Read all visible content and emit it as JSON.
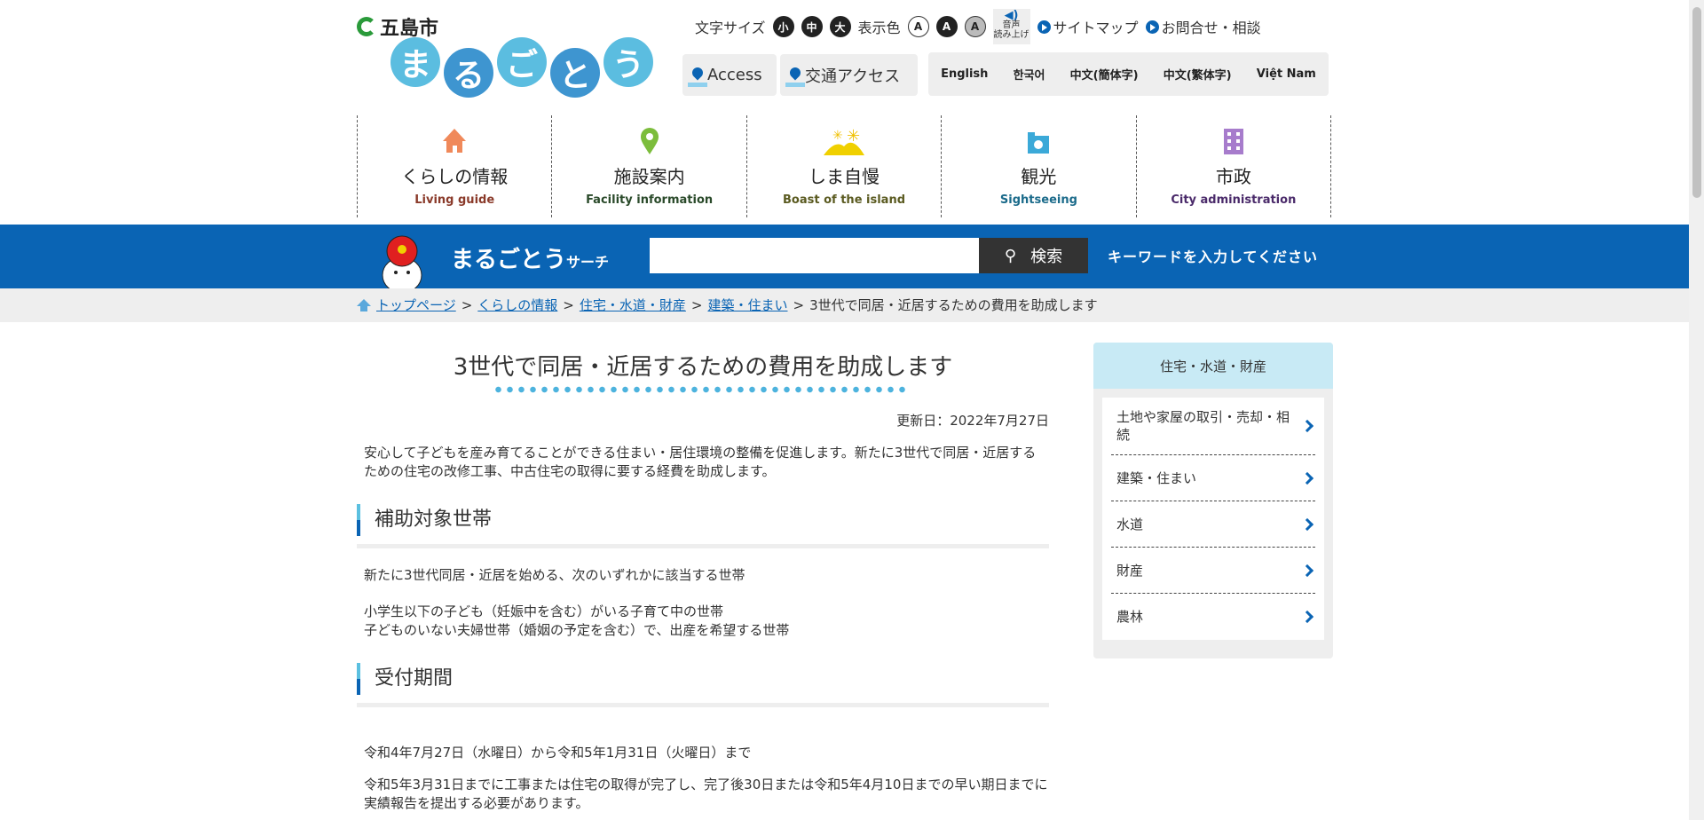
{
  "header": {
    "city": "五島市",
    "logo": "まるごとう",
    "util": {
      "font_size_label": "文字サイズ",
      "sizes": [
        "小",
        "中",
        "大"
      ],
      "color_label": "表示色",
      "colors": [
        "A",
        "A",
        "A"
      ],
      "voice": "音声",
      "voice2": "読み上げ",
      "sitemap": "サイトマップ",
      "contact": "お問合せ・相談"
    },
    "access": "Access",
    "transport": "交通アクセス",
    "languages": [
      "English",
      "한국어",
      "中文(簡体字)",
      "中文(繁体字)",
      "Việt Nam"
    ]
  },
  "nav": [
    {
      "jp": "くらしの情報",
      "en": "Living guide",
      "color": "#8a3a2a",
      "icon": "house-icon"
    },
    {
      "jp": "施設案内",
      "en": "Facility information",
      "color": "#2a4a2a",
      "icon": "map-pin-icon"
    },
    {
      "jp": "しま自慢",
      "en": "Boast of the island",
      "color": "#5a5a20",
      "icon": "island-sun-icon"
    },
    {
      "jp": "観光",
      "en": "Sightseeing",
      "color": "#1a6a8a",
      "icon": "camera-icon"
    },
    {
      "jp": "市政",
      "en": "City administration",
      "color": "#4a2a6a",
      "icon": "building-icon"
    }
  ],
  "search": {
    "logo": "まるごとう",
    "logo_suffix": "サーチ",
    "button": "検索",
    "hint": "キーワードを入力してください",
    "value": ""
  },
  "breadcrumb": {
    "links": [
      "トップページ",
      "くらしの情報",
      "住宅・水道・財産",
      "建築・住まい"
    ],
    "current": "3世代で同居・近居するための費用を助成します",
    "sep": ">"
  },
  "main": {
    "title": "3世代で同居・近居するための費用を助成します",
    "updated": "更新日：2022年7月27日",
    "intro": "安心して子どもを産み育てることができる住まい・居住環境の整備を促進します。新たに3世代で同居・近居するための住宅の改修工事、中古住宅の取得に要する経費を助成します。",
    "section1": {
      "heading": "補助対象世帯",
      "lead": "新たに3世代同居・近居を始める、次のいずれかに該当する世帯",
      "items": [
        "小学生以下の子ども（妊娠中を含む）がいる子育て中の世帯",
        "子どものいない夫婦世帯（婚姻の予定を含む）で、出産を希望する世帯"
      ]
    },
    "section2": {
      "heading": "受付期間",
      "period": "令和4年7月27日（水曜日）から令和5年1月31日（火曜日）まで",
      "note": "令和5年3月31日までに工事または住宅の取得が完了し、完了後30日または令和5年4月10日までの早い期日までに実績報告を提出する必要があります。"
    }
  },
  "sidebar": {
    "heading": "住宅・水道・財産",
    "items": [
      "土地や家屋の取引・売却・相続",
      "建築・住まい",
      "水道",
      "財産",
      "農林"
    ]
  },
  "colors": {
    "brand_blue": "#0a64b4",
    "sidebar_header": "#c8eaf5"
  }
}
